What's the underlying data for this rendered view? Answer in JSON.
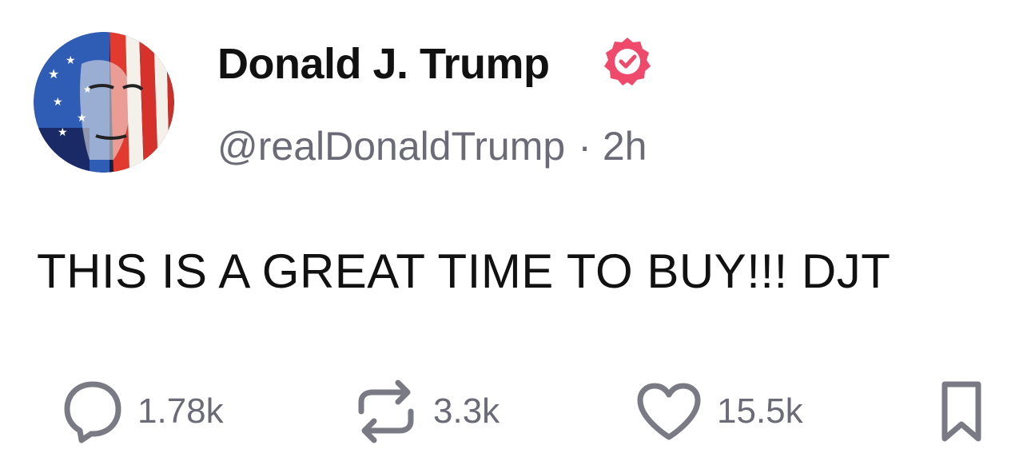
{
  "author": {
    "name": "Donald J. Trump",
    "handle": "@realDonaldTrump",
    "separator": "·",
    "time": "2h",
    "verified_color": "#ef4a6b"
  },
  "post": {
    "text": "THIS IS A GREAT TIME TO BUY!!! DJT"
  },
  "actions": {
    "replies": "1.78k",
    "reposts": "3.3k",
    "likes": "15.5k"
  },
  "colors": {
    "text": "#111111",
    "muted": "#6b6b78",
    "icon": "#7a7a85",
    "verified": "#ef4a6b"
  },
  "icons": {
    "reply": "speech-bubble-icon",
    "repost": "repost-arrows-icon",
    "like": "heart-icon",
    "bookmark": "bookmark-icon",
    "verified": "verified-badge-icon"
  }
}
